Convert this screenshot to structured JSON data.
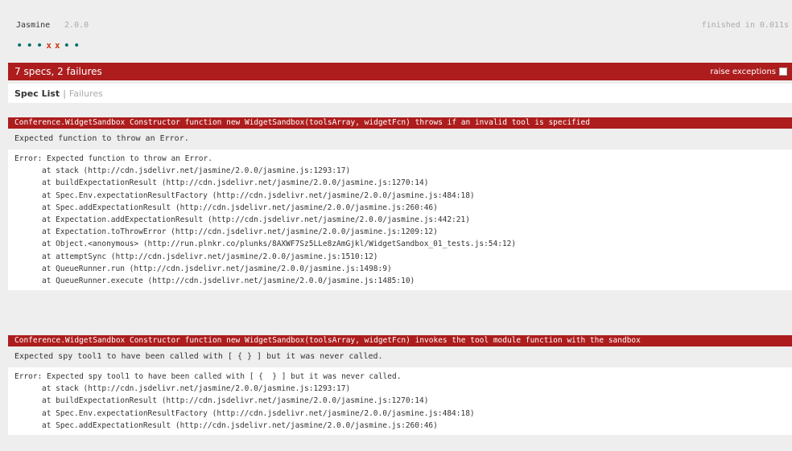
{
  "banner": {
    "title": "Jasmine",
    "version": "2.0.0",
    "duration": "finished in 0.011s",
    "symbols": [
      "•",
      "•",
      "•",
      "x",
      "x",
      "•",
      "•"
    ]
  },
  "summary": {
    "text": "7 specs, 2 failures",
    "raise_label": "raise exceptions"
  },
  "menu": {
    "spec_list": "Spec List",
    "separator": "|",
    "failures": "Failures"
  },
  "failures": [
    {
      "description": "Conference.WidgetSandbox Constructor function new WidgetSandbox(toolsArray, widgetFcn) throws if an invalid tool is specified",
      "message": "Expected function to throw an Error.",
      "stack_first": "Error: Expected function to throw an Error.",
      "stack": [
        "at stack (http://cdn.jsdelivr.net/jasmine/2.0.0/jasmine.js:1293:17)",
        "at buildExpectationResult (http://cdn.jsdelivr.net/jasmine/2.0.0/jasmine.js:1270:14)",
        "at Spec.Env.expectationResultFactory (http://cdn.jsdelivr.net/jasmine/2.0.0/jasmine.js:484:18)",
        "at Spec.addExpectationResult (http://cdn.jsdelivr.net/jasmine/2.0.0/jasmine.js:260:46)",
        "at Expectation.addExpectationResult (http://cdn.jsdelivr.net/jasmine/2.0.0/jasmine.js:442:21)",
        "at Expectation.toThrowError (http://cdn.jsdelivr.net/jasmine/2.0.0/jasmine.js:1209:12)",
        "at Object.<anonymous> (http://run.plnkr.co/plunks/8AXWF7Sz5LLe8zAmGjkl/WidgetSandbox_01_tests.js:54:12)",
        "at attemptSync (http://cdn.jsdelivr.net/jasmine/2.0.0/jasmine.js:1510:12)",
        "at QueueRunner.run (http://cdn.jsdelivr.net/jasmine/2.0.0/jasmine.js:1498:9)",
        "at QueueRunner.execute (http://cdn.jsdelivr.net/jasmine/2.0.0/jasmine.js:1485:10)"
      ]
    },
    {
      "description": "Conference.WidgetSandbox Constructor function new WidgetSandbox(toolsArray, widgetFcn) invokes the tool module function with the sandbox",
      "message": "Expected spy tool1 to have been called with [ {  } ] but it was never called.",
      "stack_first": "Error: Expected spy tool1 to have been called with [ {  } ] but it was never called.",
      "stack": [
        "at stack (http://cdn.jsdelivr.net/jasmine/2.0.0/jasmine.js:1293:17)",
        "at buildExpectationResult (http://cdn.jsdelivr.net/jasmine/2.0.0/jasmine.js:1270:14)",
        "at Spec.Env.expectationResultFactory (http://cdn.jsdelivr.net/jasmine/2.0.0/jasmine.js:484:18)",
        "at Spec.addExpectationResult (http://cdn.jsdelivr.net/jasmine/2.0.0/jasmine.js:260:46)"
      ]
    }
  ]
}
